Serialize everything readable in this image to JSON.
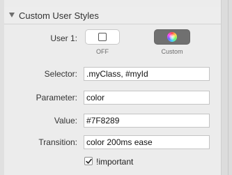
{
  "section": {
    "title": "Custom User Styles",
    "disclosure_icon": "disclosure-triangle-down-icon"
  },
  "user_toggle": {
    "label": "User 1:",
    "options": [
      {
        "label": "OFF",
        "icon": "square-outline-icon",
        "selected": false
      },
      {
        "label": "Custom",
        "icon": "color-wheel-icon",
        "selected": true
      }
    ]
  },
  "fields": {
    "selector": {
      "label": "Selector:",
      "value": ".myClass, #myId"
    },
    "parameter": {
      "label": "Parameter:",
      "value": "color"
    },
    "value": {
      "label": "Value:",
      "value": "#7F8289"
    },
    "transition": {
      "label": "Transition:",
      "value": "color 200ms ease"
    }
  },
  "important": {
    "label": "!important",
    "checked": true
  }
}
